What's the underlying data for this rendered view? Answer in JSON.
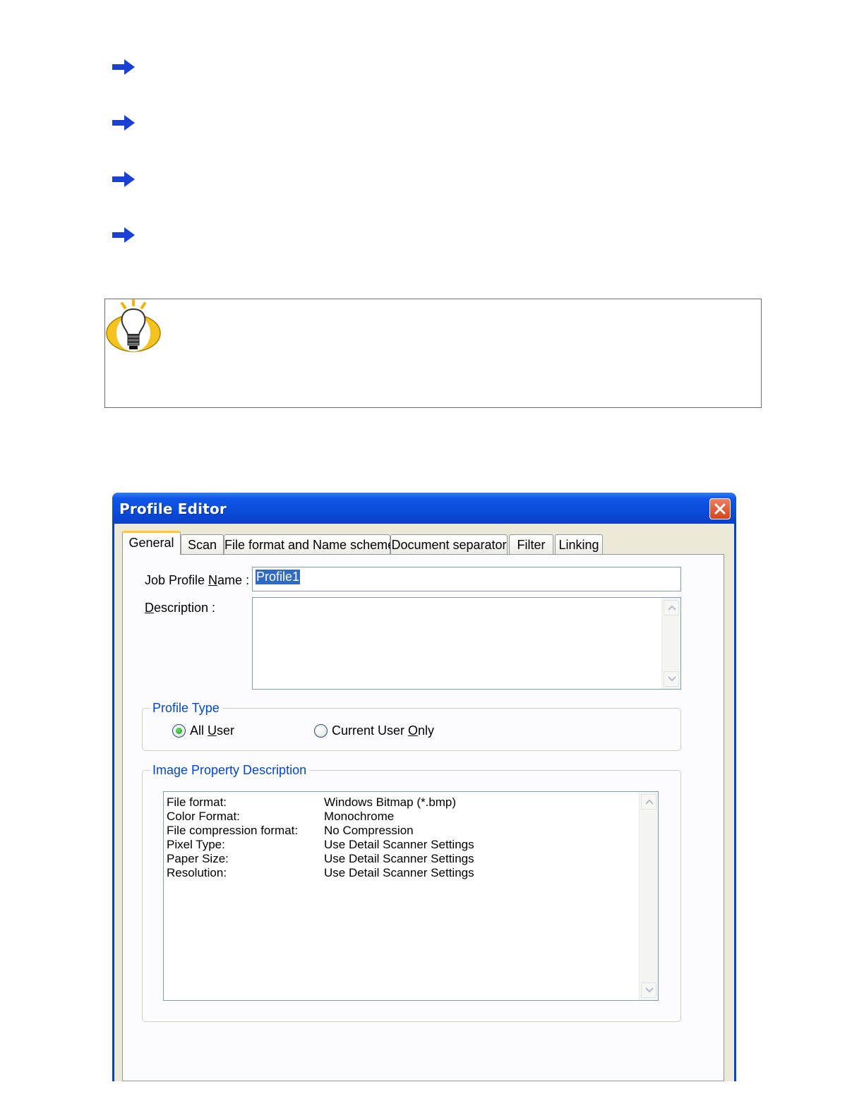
{
  "window": {
    "title": "Profile Editor"
  },
  "tabs": [
    {
      "label": "General"
    },
    {
      "label": "Scan"
    },
    {
      "label": "File format and Name scheme"
    },
    {
      "label": "Document separator"
    },
    {
      "label": "Filter"
    },
    {
      "label": "Linking"
    }
  ],
  "general": {
    "job_profile_name_label_pre": "Job Profile ",
    "job_profile_name_label_key": "N",
    "job_profile_name_label_post": "ame :",
    "job_profile_name_value": "Profile1",
    "description_label_key": "D",
    "description_label_post": "escription :",
    "description_value": ""
  },
  "profile_type": {
    "title": "Profile Type",
    "all_user_pre": "All ",
    "all_user_key": "U",
    "all_user_post": "ser",
    "current_user_pre": "Current User ",
    "current_user_key": "O",
    "current_user_post": "nly",
    "selected": "All User"
  },
  "image_property": {
    "title": "Image Property Description",
    "rows": [
      {
        "key": "File format:",
        "value": "Windows Bitmap (*.bmp)"
      },
      {
        "key": "Color Format:",
        "value": "Monochrome"
      },
      {
        "key": "File compression format:",
        "value": "No Compression"
      },
      {
        "key": "Pixel Type:",
        "value": "Use Detail Scanner Settings"
      },
      {
        "key": "Paper Size:",
        "value": "Use Detail Scanner Settings"
      },
      {
        "key": "Resolution:",
        "value": "Use Detail Scanner Settings"
      }
    ]
  },
  "icons": {
    "bullet": "arrow-right-icon",
    "tip": "lightbulb-icon",
    "close": "close-icon"
  },
  "colors": {
    "arrow": "#1a3fd6",
    "title_bar": "#0a3fd6",
    "close": "#d64418",
    "group_title": "#0046d5",
    "selection": "#316ac5"
  }
}
